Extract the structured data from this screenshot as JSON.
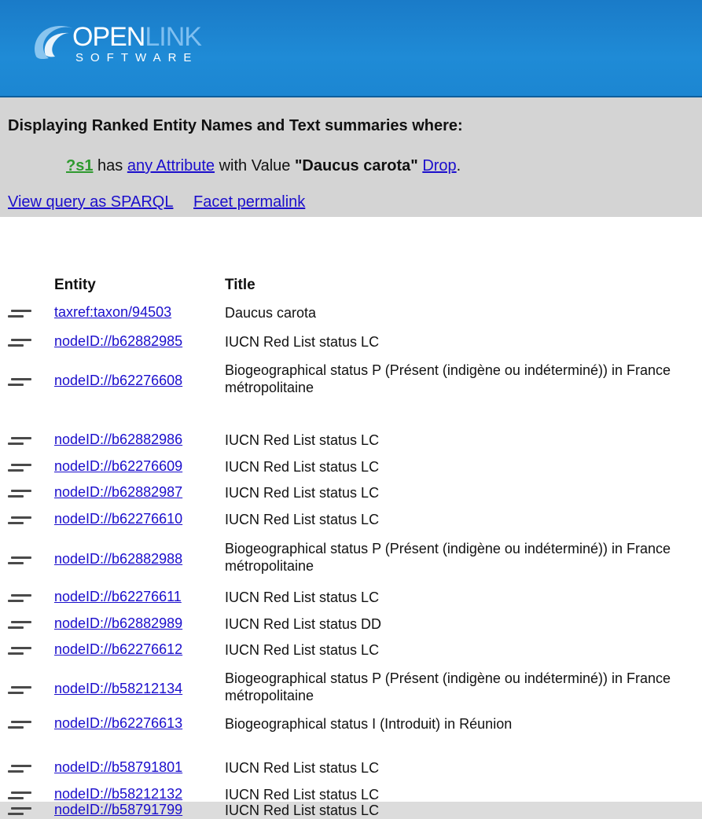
{
  "header": {
    "logo_word_open": "OPEN",
    "logo_word_link": "LINK",
    "logo_sub": "SOFTWARE",
    "brand_color": "#1f8bd6"
  },
  "query": {
    "title": "Displaying Ranked Entity Names and Text summaries where:",
    "variable": "?s1",
    "has": "has",
    "attribute_link": "any Attribute",
    "with_value": "with Value",
    "value": "\"Daucus carota\"",
    "drop": "Drop",
    "period": ".",
    "view_sparql": "View query as SPARQL",
    "permalink": "Facet permalink"
  },
  "table": {
    "headers": {
      "entity": "Entity",
      "title": "Title"
    },
    "rows": [
      {
        "entity": "taxref:taxon/94503",
        "title": "Daucus carota"
      },
      {
        "entity": "nodeID://b62882985",
        "title": "IUCN Red List status LC"
      },
      {
        "entity": "nodeID://b62276608",
        "title": "Biogeographical status P (Présent (indigène ou indéterminé)) in France métropolitaine"
      },
      {
        "entity": "nodeID://b62882986",
        "title": "IUCN Red List status LC"
      },
      {
        "entity": "nodeID://b62276609",
        "title": "IUCN Red List status LC"
      },
      {
        "entity": "nodeID://b62882987",
        "title": "IUCN Red List status LC"
      },
      {
        "entity": "nodeID://b62276610",
        "title": "IUCN Red List status LC"
      },
      {
        "entity": "nodeID://b62882988",
        "title": "Biogeographical status P (Présent (indigène ou indéterminé)) in France métropolitaine"
      },
      {
        "entity": "nodeID://b62276611",
        "title": "IUCN Red List status LC"
      },
      {
        "entity": "nodeID://b62882989",
        "title": "IUCN Red List status DD"
      },
      {
        "entity": "nodeID://b62276612",
        "title": "IUCN Red List status LC"
      },
      {
        "entity": "nodeID://b58212134",
        "title": "Biogeographical status P (Présent (indigène ou indéterminé)) in France métropolitaine"
      },
      {
        "entity": "nodeID://b62276613",
        "title": "Biogeographical status I (Introduit) in Réunion"
      },
      {
        "entity": "nodeID://b58791801",
        "title": "IUCN Red List status LC"
      },
      {
        "entity": "nodeID://b58212132",
        "title": "IUCN Red List status LC"
      },
      {
        "entity": "nodeID://b58791799",
        "title": "IUCN Red List status LC"
      }
    ]
  }
}
